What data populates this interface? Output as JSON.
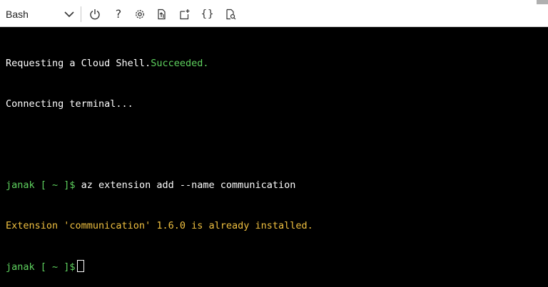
{
  "toolbar": {
    "shell_label": "Bash",
    "help_icon": "?",
    "braces_icon": "{}",
    "icons": [
      "chevron-down-icon",
      "power-icon",
      "help-icon",
      "settings-icon",
      "upload-download-icon",
      "new-session-icon",
      "braces-icon",
      "web-preview-icon"
    ]
  },
  "terminal": {
    "line1_text": "Requesting a Cloud Shell.",
    "line1_status": "Succeeded.",
    "line2": "Connecting terminal...",
    "prompt": "janak [ ~ ]$",
    "command": " az extension add --name communication",
    "output": "Extension 'communication' 1.6.0 is already installed.",
    "prompt2": "janak [ ~ ]$"
  },
  "colors": {
    "background": "#000000",
    "prompt_green": "#5fd35f",
    "warning_yellow": "#f0c040",
    "toolbar_bg": "#ffffff"
  }
}
